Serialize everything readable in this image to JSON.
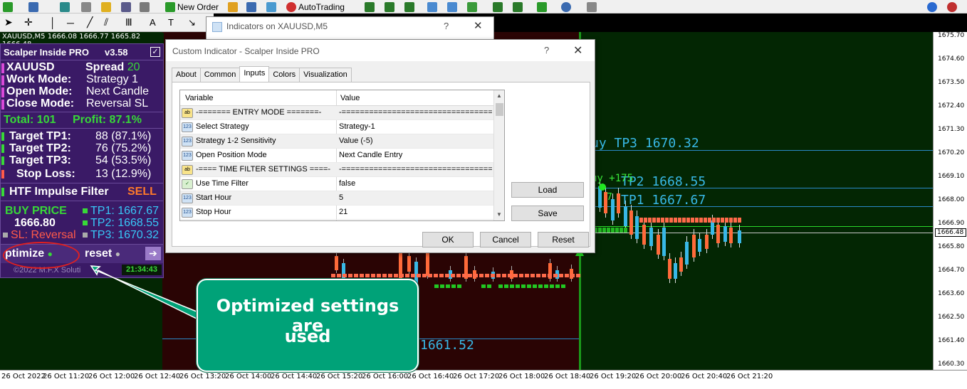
{
  "toolbar": {
    "new_order": "New Order",
    "auto_trading": "AutoTrading"
  },
  "chart": {
    "symbol_header": "XAUUSD,M5  1666.08 1666.77 1665.82 1666.48",
    "price_labels": [
      "1675.70",
      "1674.60",
      "1673.50",
      "1672.40",
      "1671.30",
      "1670.20",
      "1669.10",
      "1668.00",
      "1666.90",
      "1665.80",
      "1664.70",
      "1663.60",
      "1662.50",
      "1661.40",
      "1660.30"
    ],
    "current_price": "1666.48",
    "time_labels": [
      "26 Oct 2022",
      "26 Oct 11:20",
      "26 Oct 12:00",
      "26 Oct 12:40",
      "26 Oct 13:20",
      "26 Oct 14:00",
      "26 Oct 14:40",
      "26 Oct 15:20",
      "26 Oct 16:00",
      "26 Oct 16:40",
      "26 Oct 17:20",
      "26 Oct 18:00",
      "26 Oct 18:40",
      "26 Oct 19:20",
      "26 Oct 20:00",
      "26 Oct 20:40",
      "26 Oct 21:20"
    ],
    "tp3_label": "uy  TP3  1670.32",
    "tp2_label": "TP2  1668.55",
    "tp1_label": "TP1  1667.67",
    "buy_tag": "uy +175",
    "tp_small": "7",
    "sl_label": "1661.52",
    "colors": {
      "bg_green": "#032603",
      "bg_red": "#2a0404",
      "level": "#38b8e6"
    }
  },
  "panel": {
    "title": "Scalper Inside PRO",
    "version": "v3.58",
    "check": "✓",
    "symbol": "XAUUSD",
    "spread_label": "Spread",
    "spread_value": "20",
    "work_mode_label": "Work  Mode:",
    "work_mode_value": "Strategy 1",
    "open_mode_label": "Open  Mode:",
    "open_mode_value": "Next Candle",
    "close_mode_label": "Close Mode:",
    "close_mode_value": "Reversal SL",
    "total": "Total: 101",
    "profit": "Profit: 87.1%",
    "tp1_label": "Target TP1:",
    "tp1_value": "88 (87.1%)",
    "tp2_label": "Target TP2:",
    "tp2_value": "76 (75.2%)",
    "tp3_label": "Target TP3:",
    "tp3_value": "54 (53.5%)",
    "sl_label": "Stop Loss:",
    "sl_value": "13 (12.9%)",
    "htf_label": "HTF Impulse Filter",
    "htf_value": "SELL",
    "buy_price_label": "BUY PRICE",
    "buy_price_value": "1666.80",
    "sl_reversal": "SL: Reversal",
    "tp1_price": "TP1: 1667.67",
    "tp2_price": "TP2: 1668.55",
    "tp3_price": "TP3: 1670.32",
    "optimize_label": "ptimize",
    "optimize_dot": "●",
    "preset_label": "reset",
    "preset_dot": "●",
    "arrow": "➔",
    "copyright": "©2022  M.F.X  Soluti",
    "clock": "21:34:43"
  },
  "dialog_back": {
    "title": "Indicators on XAUUSD,M5",
    "help": "?",
    "close": "✕"
  },
  "dialog": {
    "title": "Custom Indicator - Scalper Inside PRO",
    "help": "?",
    "close": "✕",
    "tabs": [
      "About",
      "Common",
      "Inputs",
      "Colors",
      "Visualization"
    ],
    "active_tab": "Inputs",
    "col_variable": "Variable",
    "col_value": "Value",
    "rows": [
      {
        "icon": "ab",
        "variable": "-=======  ENTRY  MODE  =======-",
        "value": "-========================================-"
      },
      {
        "icon": "123",
        "variable": "Select Strategy",
        "value": "Strategy-1"
      },
      {
        "icon": "123",
        "variable": "Strategy 1-2 Sensitivity",
        "value": "Value (-5)"
      },
      {
        "icon": "123",
        "variable": "Open Position Mode",
        "value": "Next Candle Entry"
      },
      {
        "icon": "ab",
        "variable": "-==== TIME FILTER SETTINGS ====-",
        "value": "-========================================-"
      },
      {
        "icon": "chk",
        "variable": "Use Time Filter",
        "value": "false"
      },
      {
        "icon": "123",
        "variable": "Start Hour",
        "value": "5"
      },
      {
        "icon": "123",
        "variable": "Stop Hour",
        "value": "21"
      }
    ],
    "load": "Load",
    "save": "Save",
    "ok": "OK",
    "cancel": "Cancel",
    "reset": "Reset"
  },
  "callout": {
    "line1": "Optimized settings are",
    "line2": "used"
  }
}
